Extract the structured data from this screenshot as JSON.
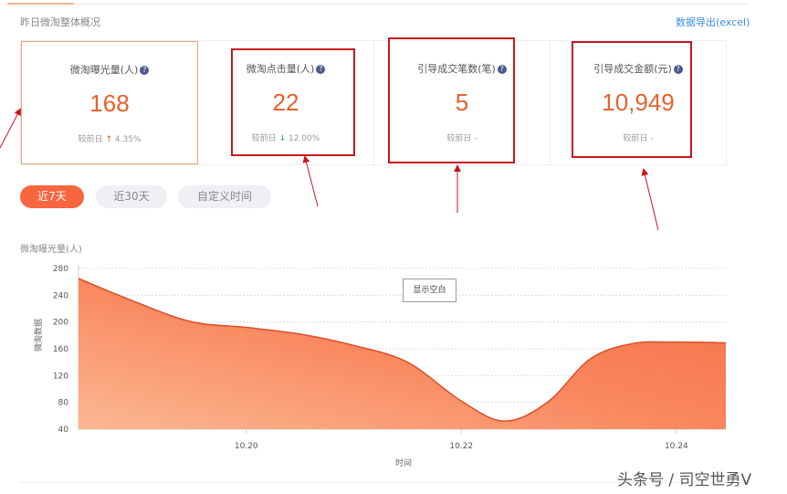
{
  "header": {
    "section_title": "昨日微淘整体概况",
    "export_label": "数据导出(excel)"
  },
  "cards": [
    {
      "label": "微淘曝光量(人)",
      "value": "168",
      "compare_label": "较前日",
      "trend": "up",
      "change": "4.35%"
    },
    {
      "label": "微淘点击量(人)",
      "value": "22",
      "compare_label": "较前日",
      "trend": "down",
      "change": "12.00%"
    },
    {
      "label": "引导成交笔数(笔)",
      "value": "5",
      "compare_label": "较前日",
      "trend": "none",
      "change": "-"
    },
    {
      "label": "引导成交金额(元)",
      "value": "10,949",
      "compare_label": "较前日",
      "trend": "none",
      "change": "-"
    }
  ],
  "range_buttons": [
    "近7天",
    "近30天",
    "自定义时间"
  ],
  "chart_data": {
    "type": "area",
    "title": "微淘曝光量(人)",
    "xlabel": "时间",
    "ylabel": "微淘数据",
    "ylim": [
      40,
      280
    ],
    "yticks": [
      40,
      80,
      120,
      160,
      200,
      240,
      280
    ],
    "xticks": [
      {
        "label": "10.20",
        "day": 20
      },
      {
        "label": "10.22",
        "day": 22
      },
      {
        "label": "10.24",
        "day": 24
      }
    ],
    "xlim": [
      18.44,
      24.46
    ],
    "points": [
      [
        18.44,
        265
      ],
      [
        19.0,
        228
      ],
      [
        19.5,
        200
      ],
      [
        20,
        192
      ],
      [
        20.5,
        182
      ],
      [
        21,
        165
      ],
      [
        21.5,
        140
      ],
      [
        22,
        82
      ],
      [
        22.4,
        52
      ],
      [
        22.8,
        80
      ],
      [
        23.2,
        145
      ],
      [
        23.6,
        168
      ],
      [
        24,
        170
      ],
      [
        24.46,
        169
      ]
    ],
    "color": "#f4724a",
    "blank_button": "显示空白"
  },
  "watermark": "头条号 / 司空世勇V",
  "colors": {
    "accent": "#f7663f",
    "annotation": "#c8161d"
  }
}
